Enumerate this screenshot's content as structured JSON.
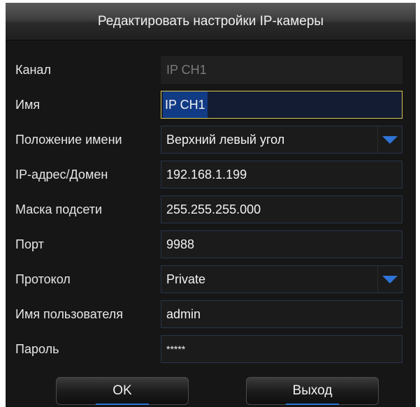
{
  "dialog": {
    "title": "Редактировать настройки IP-камеры"
  },
  "fields": {
    "channel": {
      "label": "Канал",
      "value": "IP CH1"
    },
    "name": {
      "label": "Имя",
      "value": "IP CH1"
    },
    "name_position": {
      "label": "Положение имени",
      "value": "Верхний левый угол"
    },
    "ip_domain": {
      "label": "IP-адрес/Домен",
      "value": "192.168.1.199"
    },
    "subnet_mask": {
      "label": "Маска подсети",
      "value": "255.255.255.000"
    },
    "port": {
      "label": "Порт",
      "value": "9988"
    },
    "protocol": {
      "label": "Протокол",
      "value": "Private"
    },
    "username": {
      "label": "Имя пользователя",
      "value": "admin"
    },
    "password": {
      "label": "Пароль",
      "value": "*****"
    }
  },
  "buttons": {
    "ok": "OK",
    "exit": "Выход"
  },
  "colors": {
    "accent": "#2f74d6",
    "focus_border": "#d8c64a",
    "background": "#161616"
  },
  "icons": {
    "dropdown": "chevron-down-icon"
  }
}
